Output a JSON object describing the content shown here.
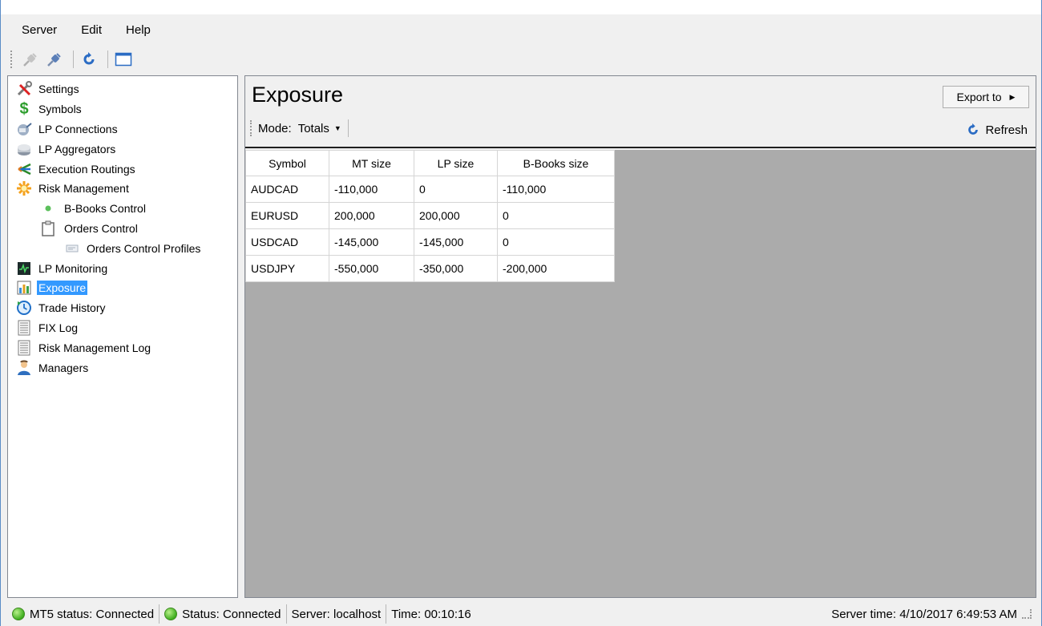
{
  "menu": {
    "items": [
      "Server",
      "Edit",
      "Help"
    ]
  },
  "toolbar": {
    "buttons": [
      "connect-icon",
      "disconnect-icon",
      "refresh-icon",
      "window-icon"
    ]
  },
  "sidebar": {
    "items": [
      {
        "label": "Settings",
        "icon": "tools-icon"
      },
      {
        "label": "Symbols",
        "icon": "dollar-icon"
      },
      {
        "label": "LP Connections",
        "icon": "lp-connections-icon"
      },
      {
        "label": "LP Aggregators",
        "icon": "aggregators-icon"
      },
      {
        "label": "Execution Routings",
        "icon": "routing-icon"
      },
      {
        "label": "Risk Management",
        "icon": "risk-icon"
      },
      {
        "label": "B-Books Control",
        "icon": "bullet-icon"
      },
      {
        "label": "Orders Control",
        "icon": "clipboard-icon"
      },
      {
        "label": "Orders Control Profiles",
        "icon": "profile-icon"
      },
      {
        "label": "LP Monitoring",
        "icon": "monitor-icon"
      },
      {
        "label": "Exposure",
        "icon": "chart-icon"
      },
      {
        "label": "Trade History",
        "icon": "history-icon"
      },
      {
        "label": "FIX Log",
        "icon": "log-icon"
      },
      {
        "label": "Risk Management Log",
        "icon": "log-icon"
      },
      {
        "label": "Managers",
        "icon": "user-icon"
      }
    ],
    "selected": "Exposure"
  },
  "main": {
    "title": "Exposure",
    "export_label": "Export to",
    "mode_label": "Mode:",
    "mode_value": "Totals",
    "refresh_label": "Refresh",
    "table": {
      "headers": [
        "Symbol",
        "MT size",
        "LP size",
        "B-Books size"
      ],
      "rows": [
        [
          "AUDCAD",
          "-110,000",
          "0",
          "-110,000"
        ],
        [
          "EURUSD",
          "200,000",
          "200,000",
          "0"
        ],
        [
          "USDCAD",
          "-145,000",
          "-145,000",
          "0"
        ],
        [
          "USDJPY",
          "-550,000",
          "-350,000",
          "-200,000"
        ]
      ]
    }
  },
  "status": {
    "mt5": "MT5 status: Connected",
    "status": "Status: Connected",
    "server": "Server: localhost",
    "time": "Time: 00:10:16",
    "server_time": "Server time: 4/10/2017 6:49:53 AM"
  },
  "colors": {
    "selection": "#3399ff",
    "grid_background": "#ababab",
    "status_ok": "#3fae1f"
  }
}
